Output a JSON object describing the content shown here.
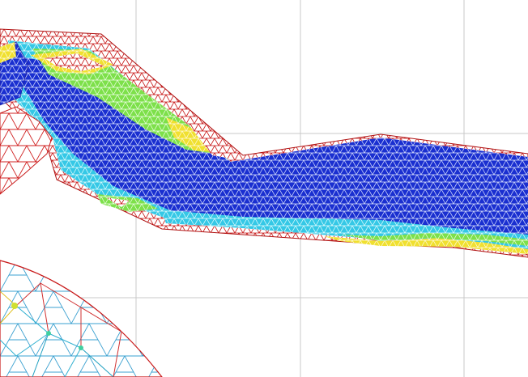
{
  "viewport": {
    "background": "#ffffff",
    "grid_visible": true,
    "grid_color": "#c8c8c8"
  },
  "mesh": {
    "type": "triangulated-mesh-contour",
    "colormap": [
      "#b00000",
      "#e0e000",
      "#60e060",
      "#30d0e0",
      "#2050ff",
      "#000090"
    ],
    "edge_color": "#d02020"
  }
}
